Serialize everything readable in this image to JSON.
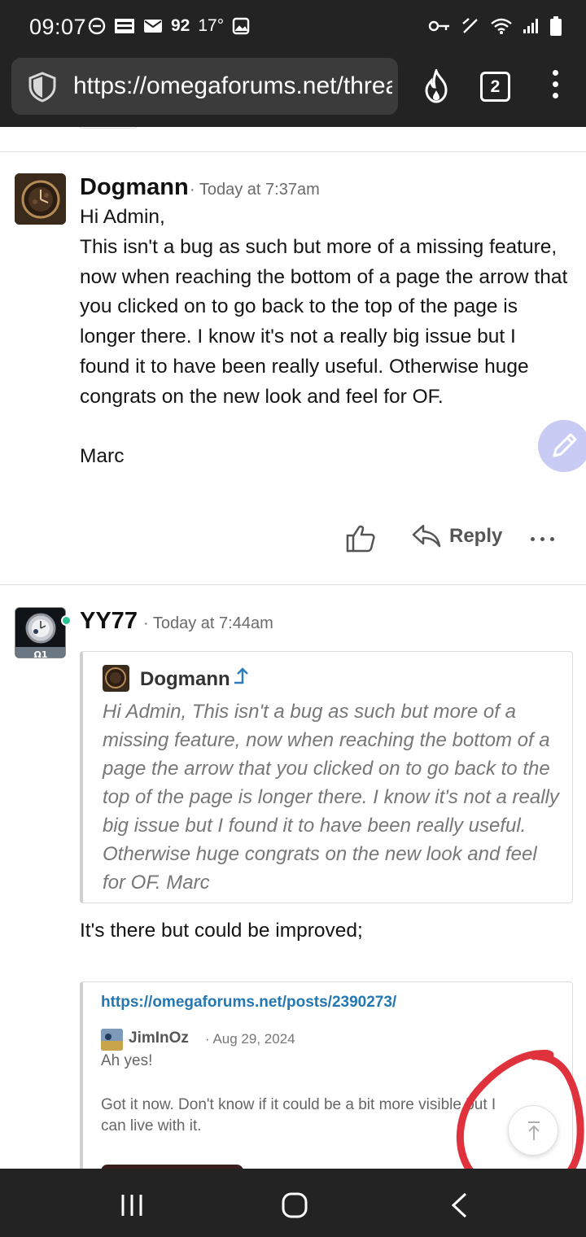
{
  "status_bar": {
    "time": "09:07",
    "email_count": "92",
    "temperature": "17°"
  },
  "browser": {
    "url": "https://omegaforums.net/threads/",
    "tab_count": "2"
  },
  "posts": [
    {
      "author": "Dogmann",
      "time": "Today at 7:37am",
      "body": "Hi Admin,\nThis isn't a bug as such but more of a missing feature, now when reaching the bottom of a page the arrow that you clicked on to go back to the top of the page is longer there. I know it's not a really big issue but I found it to have been really useful. Otherwise huge congrats on the new look and feel for OF.\n\nMarc",
      "reply_label": "Reply"
    },
    {
      "author": "YY77",
      "time": "Today at 7:44am",
      "avatar_badge": "Ω1",
      "quote": {
        "author": "Dogmann",
        "text": "Hi Admin, This isn't a bug as such but more of a missing feature, now when reaching the bottom of a page the arrow that you clicked on to go back to the top of the page is longer there. I know it's not a really big issue but I found it to have been really useful. Otherwise huge congrats on the new look and feel for OF. Marc"
      },
      "body": "It's there but could be improved;",
      "embed": {
        "url": "https://omegaforums.net/posts/2390273/",
        "author": "JimInOz",
        "date": "Aug 29, 2024",
        "line1": "Ah yes!",
        "line2": "Got it now. Don't know if it could be a bit more visible but I can live with it."
      }
    }
  ],
  "colors": {
    "accent_link": "#2577b1",
    "fab": "#c8cbf4",
    "online": "#2ac48f",
    "annotation": "#e0323c"
  }
}
